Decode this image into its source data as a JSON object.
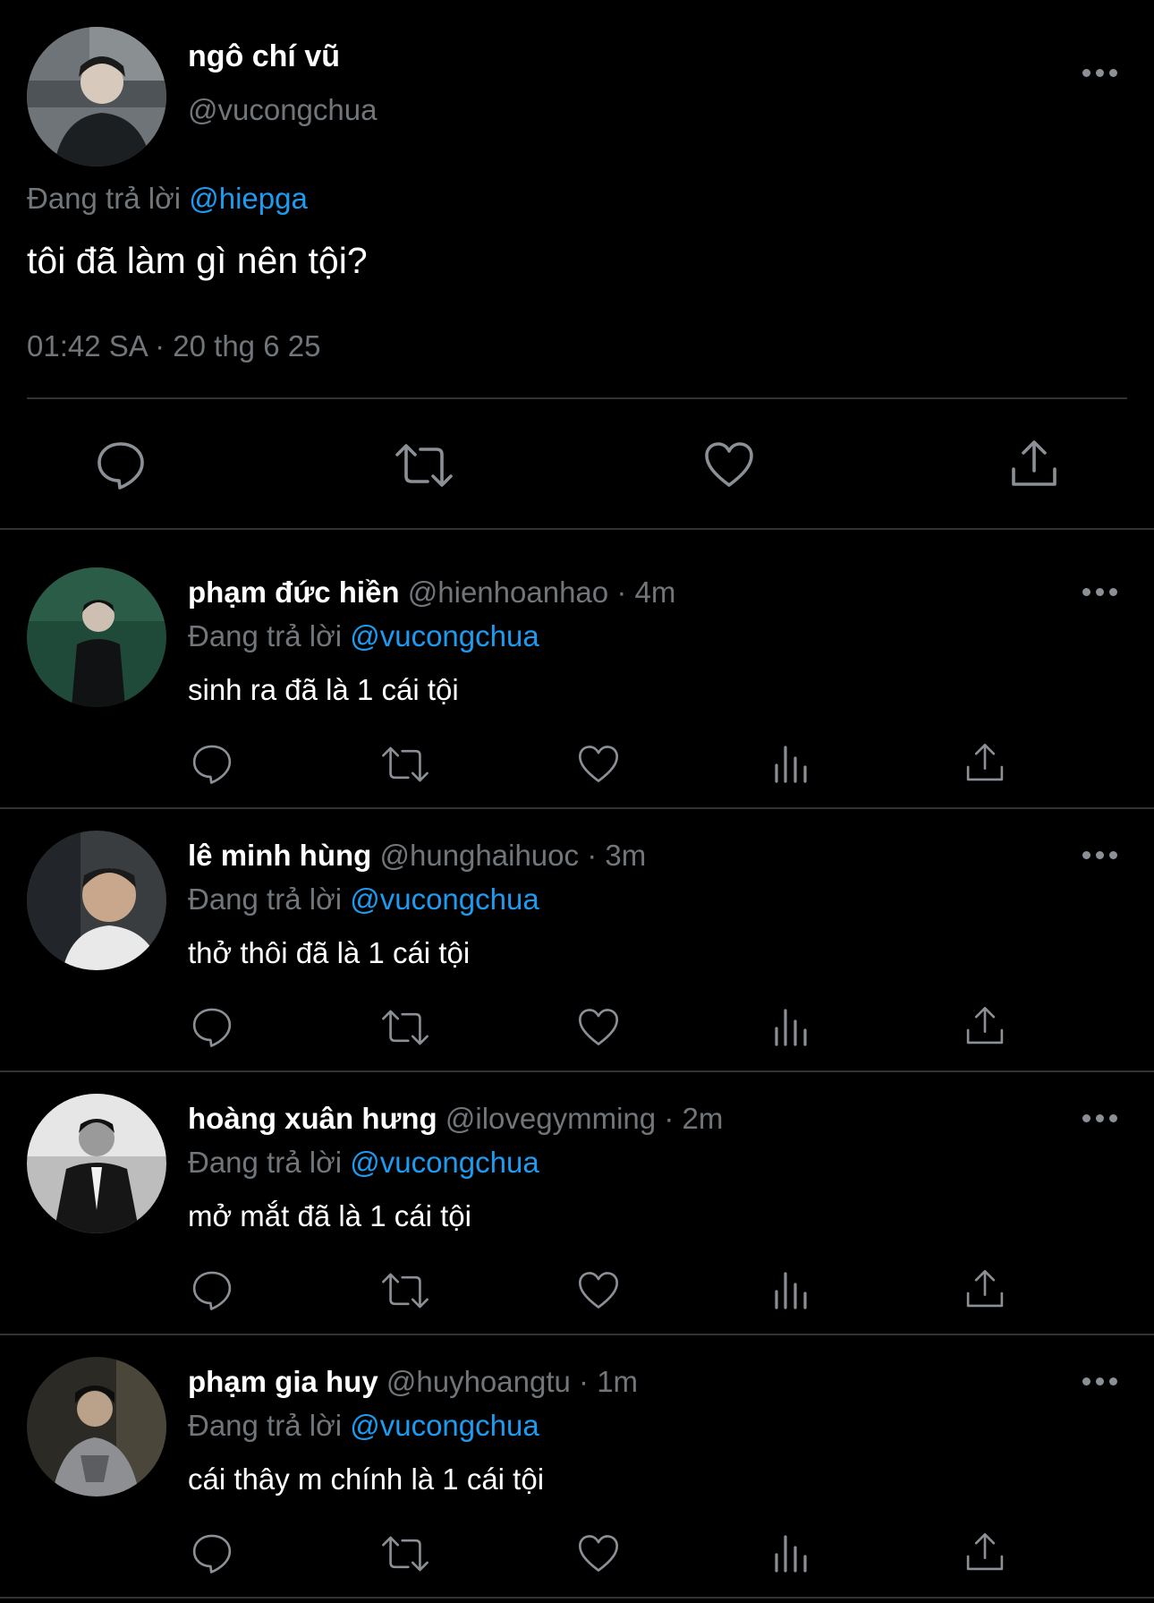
{
  "main_tweet": {
    "display_name": "ngô chí vũ",
    "handle": "@vucongchua",
    "replying_prefix": "Đang trả lời",
    "replying_to": "@hiepga",
    "text": "tôi đã làm gì nên tội?",
    "timestamp": "01:42 SA · 20 thg 6 25",
    "actions": [
      "reply-icon",
      "retweet-icon",
      "like-icon",
      "share-icon"
    ]
  },
  "replies": [
    {
      "display_name": "phạm đức hiền",
      "handle": "@hienhoanhao",
      "time": "· 4m",
      "replying_prefix": "Đang trả lời",
      "replying_to": "@vucongchua",
      "text": "sinh ra đã là 1 cái tội"
    },
    {
      "display_name": "lê minh hùng",
      "handle": "@hunghaihuoc",
      "time": "· 3m",
      "replying_prefix": "Đang trả lời",
      "replying_to": "@vucongchua",
      "text": "thở thôi đã là 1 cái tội"
    },
    {
      "display_name": "hoàng xuân hưng",
      "handle": "@ilovegymming",
      "time": "· 2m",
      "replying_prefix": "Đang trả lời",
      "replying_to": "@vucongchua",
      "text": "mở mắt đã là 1 cái tội"
    },
    {
      "display_name": "phạm gia huy",
      "handle": "@huyhoangtu",
      "time": "· 1m",
      "replying_prefix": "Đang trả lời",
      "replying_to": "@vucongchua",
      "text": "cái thây m chính là 1 cái tội"
    }
  ],
  "reply_actions": [
    "reply-icon",
    "retweet-icon",
    "like-icon",
    "views-icon",
    "share-icon"
  ],
  "colors": {
    "background": "#000000",
    "text": "#e7e9ea",
    "muted": "#71767b",
    "accent": "#1d9bf0",
    "divider": "#2f3336"
  }
}
